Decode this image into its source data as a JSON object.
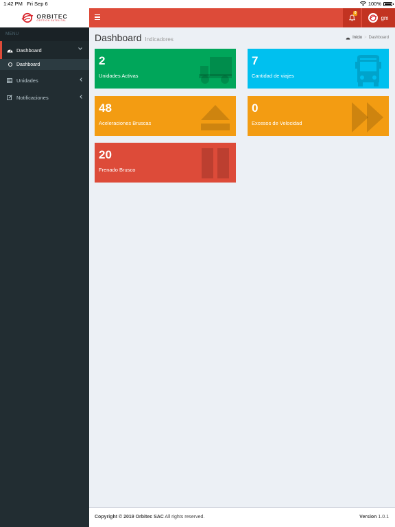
{
  "status_bar": {
    "time": "1:42 PM",
    "date": "Fri Sep 6",
    "battery": "100%"
  },
  "brand": {
    "name": "ORBITEC",
    "tagline": "GESTION SATELITAL",
    "color": "#d9262d"
  },
  "header": {
    "notif_count": "0",
    "user": "gm",
    "color": "#dd4b39"
  },
  "sidebar": {
    "menu_header": "MENU",
    "items": [
      {
        "label": "Dashboard",
        "icon": "dashboard-icon"
      },
      {
        "label": "Dashboard",
        "icon": "circle-o-icon"
      },
      {
        "label": "Unidades",
        "icon": "table-icon"
      },
      {
        "label": "Notificaciones",
        "icon": "edit-icon"
      }
    ]
  },
  "content": {
    "title": "Dashboard",
    "subtitle": "Indicadores",
    "breadcrumb": {
      "home": "Inicio",
      "current": "Dashboard"
    }
  },
  "boxes": [
    {
      "value": "2",
      "label": "Unidades Activas",
      "color": "#00a65a",
      "icon": "truck-icon"
    },
    {
      "value": "7",
      "label": "Cantidad de viajes",
      "color": "#00c0ef",
      "icon": "bus-icon"
    },
    {
      "value": "48",
      "label": "Aceleraciones Bruscas",
      "color": "#f39c12",
      "icon": "eject-icon"
    },
    {
      "value": "0",
      "label": "Excesos de Velocidad",
      "color": "#f39c12",
      "icon": "fast-forward-icon"
    },
    {
      "value": "20",
      "label": "Frenado Brusco",
      "color": "#dd4b39",
      "icon": "pause-icon"
    }
  ],
  "footer": {
    "copyright": "Copyright © 2019 Orbitec SAC",
    "rights": "All rights reserved.",
    "version_label": "Version",
    "version": "1.0.1"
  }
}
